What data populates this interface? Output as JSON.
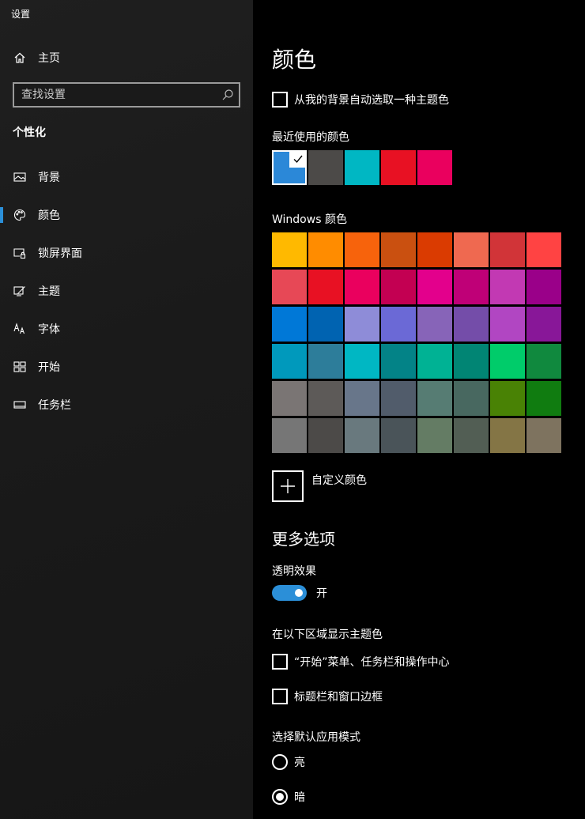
{
  "window": {
    "title": "设置"
  },
  "sidebar": {
    "home_label": "主页",
    "search_placeholder": "查找设置",
    "section_title": "个性化",
    "items": [
      {
        "label": "背景",
        "icon": "image-icon",
        "active": false
      },
      {
        "label": "颜色",
        "icon": "palette-icon",
        "active": true
      },
      {
        "label": "锁屏界面",
        "icon": "lock-screen-icon",
        "active": false
      },
      {
        "label": "主题",
        "icon": "theme-icon",
        "active": false
      },
      {
        "label": "字体",
        "icon": "font-icon",
        "active": false
      },
      {
        "label": "开始",
        "icon": "start-icon",
        "active": false
      },
      {
        "label": "任务栏",
        "icon": "taskbar-icon",
        "active": false
      }
    ]
  },
  "main": {
    "title": "颜色",
    "auto_pick_label": "从我的背景自动选取一种主题色",
    "recent_title": "最近使用的颜色",
    "recent_colors": [
      "#2b88d8",
      "#4c4a48",
      "#00b7c3",
      "#e81123",
      "#ea005e"
    ],
    "recent_selected_index": 0,
    "windows_colors_title": "Windows 颜色",
    "windows_colors": [
      [
        "#ffb900",
        "#ff8c00",
        "#f7630c",
        "#ca5010",
        "#da3b01",
        "#ef6950",
        "#d13438",
        "#ff4343"
      ],
      [
        "#e74856",
        "#e81123",
        "#ea005e",
        "#c30052",
        "#e3008c",
        "#bf0077",
        "#c239b3",
        "#9a0089"
      ],
      [
        "#0078d7",
        "#0063b1",
        "#8e8cd8",
        "#6b69d6",
        "#8764b8",
        "#744da9",
        "#b146c2",
        "#881798"
      ],
      [
        "#0099bc",
        "#2d7d9a",
        "#00b7c3",
        "#038387",
        "#00b294",
        "#018574",
        "#00cc6a",
        "#10893e"
      ],
      [
        "#7a7574",
        "#5d5a58",
        "#68768a",
        "#515c6b",
        "#567c73",
        "#486860",
        "#498205",
        "#107c10"
      ],
      [
        "#767676",
        "#4c4a48",
        "#69797e",
        "#4a5459",
        "#647c64",
        "#525e54",
        "#847545",
        "#7e735f"
      ]
    ],
    "custom_color_label": "自定义颜色",
    "more_options_title": "更多选项",
    "transparency_title": "透明效果",
    "transparency_state": "开",
    "accent_surfaces_title": "在以下区域显示主题色",
    "accent_start_label": "“开始”菜单、任务栏和操作中心",
    "accent_titlebar_label": "标题栏和窗口边框",
    "app_mode_title": "选择默认应用模式",
    "app_mode_light": "亮",
    "app_mode_dark": "暗",
    "app_mode_selected": "暗"
  },
  "colors": {
    "accent": "#2b8fd8",
    "sidebar_bg": "#1c1c1c",
    "main_bg": "#000000"
  }
}
